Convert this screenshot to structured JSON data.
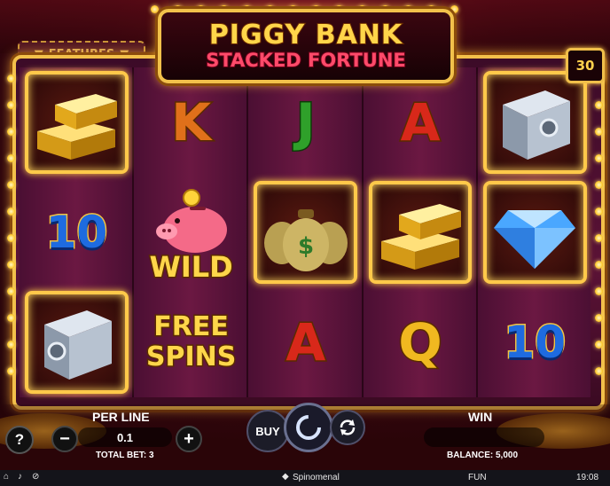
{
  "title": {
    "line1": "PIGGY BANK",
    "line2": "STACKED FORTUNE"
  },
  "features_label": "FEATURES",
  "lines_count": "30",
  "symbols": {
    "k": "K",
    "j": "J",
    "a": "A",
    "q": "Q",
    "ten": "10",
    "wild": "WILD",
    "free": "FREE",
    "spins": "SPINS",
    "dollar": "$"
  },
  "reels": [
    [
      "gold-bars",
      "ten",
      "safe"
    ],
    [
      "k",
      "wild-piggy",
      "free-spins"
    ],
    [
      "j",
      "money-bags",
      "a"
    ],
    [
      "a",
      "gold-bars",
      "q"
    ],
    [
      "safe",
      "diamond",
      "ten"
    ]
  ],
  "controls": {
    "help_label": "?",
    "per_line_label": "PER LINE",
    "per_line_value": "0.1",
    "minus_label": "−",
    "plus_label": "+",
    "total_bet_label": "TOTAL BET: 3",
    "buy_label": "BUY",
    "win_label": "WIN",
    "win_value": "",
    "balance_label": "BALANCE: 5,000"
  },
  "statusbar": {
    "brand": "Spinomenal",
    "mode": "FUN",
    "time": "19:08",
    "icons": [
      "home-icon",
      "sound-icon",
      "no-turbo-icon"
    ]
  },
  "colors": {
    "gold": "#f2c14b",
    "frame_bg": "#5b1236",
    "ten_blue": "#1e6be0",
    "letter_red": "#d8281a",
    "j_green": "#2fa02a"
  }
}
